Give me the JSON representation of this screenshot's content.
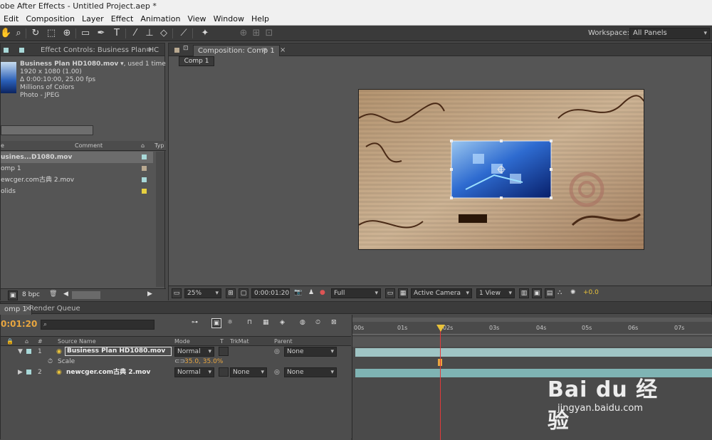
{
  "window": {
    "title": "obe After Effects - Untitled Project.aep *"
  },
  "menu": [
    "Edit",
    "Composition",
    "Layer",
    "Effect",
    "Animation",
    "View",
    "Window",
    "Help"
  ],
  "workspace": {
    "label": "Workspace:",
    "value": "All Panels"
  },
  "project_panel": {
    "tab_label": "Effect Controls: Business Plan HC",
    "footage": {
      "name": "Business Plan HD1080.mov",
      "used": ", used 1 time",
      "size": "1920 x 1080 (1.00)",
      "duration": "Δ 0:00:10:00, 25.00 fps",
      "colors": "Millions of Colors",
      "codec": "Photo - JPEG"
    },
    "columns": {
      "name": "e",
      "comment": "Comment",
      "type": "Typ"
    },
    "items": [
      {
        "label": "usines...D1080.mov",
        "color": "#a8d8d8"
      },
      {
        "label": "omp 1",
        "color": "#b8a890"
      },
      {
        "label": "ewcger.com古典 2.mov",
        "color": "#a8d8d8"
      },
      {
        "label": "olids",
        "color": "#e6d040"
      }
    ],
    "bpc": "8 bpc"
  },
  "comp_panel": {
    "tab_label": "Composition: Comp 1",
    "breadcrumb": "Comp 1",
    "zoom": "25%",
    "timecode": "0:00:01:20",
    "resolution": "Full",
    "camera": "Active Camera",
    "views": "1 View",
    "exposure": "+0.0"
  },
  "timeline": {
    "tabs": [
      "omp 1",
      "Render Queue"
    ],
    "current_time": "0:01:20",
    "columns": {
      "source": "Source Name",
      "mode": "Mode",
      "t": "T",
      "trkmat": "TrkMat",
      "parent": "Parent"
    },
    "layers": [
      {
        "num": "1",
        "name": "Business Plan HD1080.mov",
        "mode": "Normal",
        "trkmat": "",
        "parent": "None"
      },
      {
        "num": "2",
        "name": "newcger.com古典 2.mov",
        "mode": "Normal",
        "trkmat": "None",
        "parent": "None"
      }
    ],
    "property": {
      "name": "Scale",
      "value": "35.0, 35.0%"
    },
    "ruler": [
      "00s",
      "01s",
      "02s",
      "03s",
      "04s",
      "05s",
      "06s",
      "07s"
    ]
  },
  "watermark": {
    "brand": "Bai du 经验",
    "url": "jingyan.baidu.com"
  }
}
